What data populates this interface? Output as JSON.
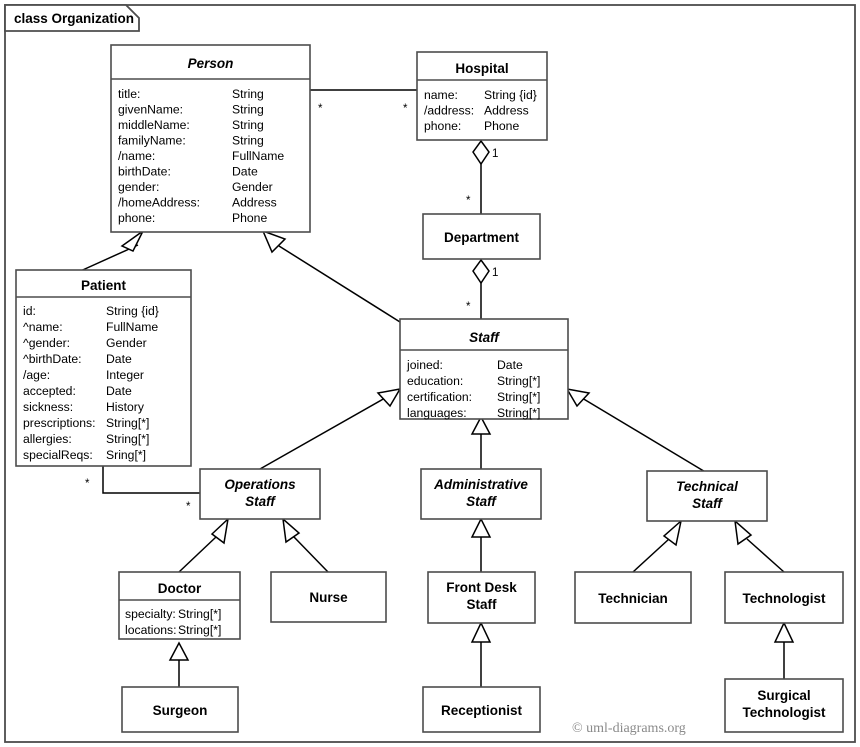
{
  "frame": {
    "label": "class Organization",
    "kind": "uml-class-diagram"
  },
  "copyright": "© uml-diagrams.org",
  "classes": {
    "person": {
      "name": "Person",
      "abstract": true,
      "attributes": [
        {
          "name": "title:",
          "type": "String"
        },
        {
          "name": "givenName:",
          "type": "String"
        },
        {
          "name": "middleName:",
          "type": "String"
        },
        {
          "name": "familyName:",
          "type": "String"
        },
        {
          "name": "/name:",
          "type": "FullName"
        },
        {
          "name": "birthDate:",
          "type": "Date"
        },
        {
          "name": "gender:",
          "type": "Gender"
        },
        {
          "name": "/homeAddress:",
          "type": "Address"
        },
        {
          "name": "phone:",
          "type": "Phone"
        }
      ]
    },
    "hospital": {
      "name": "Hospital",
      "abstract": false,
      "attributes": [
        {
          "name": "name:",
          "type": "String {id}"
        },
        {
          "name": "/address:",
          "type": "Address"
        },
        {
          "name": "phone:",
          "type": "Phone"
        }
      ]
    },
    "department": {
      "name": "Department",
      "abstract": false,
      "attributes": []
    },
    "patient": {
      "name": "Patient",
      "abstract": false,
      "attributes": [
        {
          "name": "id:",
          "type": "String {id}"
        },
        {
          "name": "^name:",
          "type": "FullName"
        },
        {
          "name": "^gender:",
          "type": "Gender"
        },
        {
          "name": "^birthDate:",
          "type": "Date"
        },
        {
          "name": "/age:",
          "type": "Integer"
        },
        {
          "name": "accepted:",
          "type": "Date"
        },
        {
          "name": "sickness:",
          "type": "History"
        },
        {
          "name": "prescriptions:",
          "type": "String[*]"
        },
        {
          "name": "allergies:",
          "type": "String[*]"
        },
        {
          "name": "specialReqs:",
          "type": "Sring[*]"
        }
      ]
    },
    "staff": {
      "name": "Staff",
      "abstract": true,
      "attributes": [
        {
          "name": "joined:",
          "type": "Date"
        },
        {
          "name": "education:",
          "type": "String[*]"
        },
        {
          "name": "certification:",
          "type": "String[*]"
        },
        {
          "name": "languages:",
          "type": "String[*]"
        }
      ]
    },
    "operations_staff": {
      "name": "Operations Staff",
      "name_line1": "Operations",
      "name_line2": "Staff",
      "abstract": true,
      "attributes": []
    },
    "administrative_staff": {
      "name": "Administrative Staff",
      "name_line1": "Administrative",
      "name_line2": "Staff",
      "abstract": true,
      "attributes": []
    },
    "technical_staff": {
      "name": "Technical Staff",
      "name_line1": "Technical",
      "name_line2": "Staff",
      "abstract": true,
      "attributes": []
    },
    "doctor": {
      "name": "Doctor",
      "abstract": false,
      "attributes": [
        {
          "name": "specialty:",
          "type": "String[*]"
        },
        {
          "name": "locations:",
          "type": "String[*]"
        }
      ]
    },
    "nurse": {
      "name": "Nurse",
      "abstract": false,
      "attributes": []
    },
    "front_desk_staff": {
      "name": "Front Desk Staff",
      "name_line1": "Front Desk",
      "name_line2": "Staff",
      "abstract": false,
      "attributes": []
    },
    "technician": {
      "name": "Technician",
      "abstract": false,
      "attributes": []
    },
    "technologist": {
      "name": "Technologist",
      "abstract": false,
      "attributes": []
    },
    "surgeon": {
      "name": "Surgeon",
      "abstract": false,
      "attributes": []
    },
    "receptionist": {
      "name": "Receptionist",
      "abstract": false,
      "attributes": []
    },
    "surgical_technologist": {
      "name": "Surgical Technologist",
      "name_line1": "Surgical",
      "name_line2": "Technologist",
      "abstract": false,
      "attributes": []
    }
  },
  "multiplicities": {
    "person_hospital_source": "*",
    "person_hospital_target": "*",
    "hospital_department_whole": "1",
    "hospital_department_part": "*",
    "department_staff_whole": "1",
    "department_staff_part": "*",
    "patient_operations_source": "*",
    "patient_operations_target": "*"
  },
  "relationships": [
    {
      "kind": "association",
      "from": "Person",
      "to": "Hospital",
      "from_mult": "*",
      "to_mult": "*"
    },
    {
      "kind": "aggregation",
      "whole": "Hospital",
      "part": "Department",
      "whole_mult": "1",
      "part_mult": "*"
    },
    {
      "kind": "aggregation",
      "whole": "Department",
      "part": "Staff",
      "whole_mult": "1",
      "part_mult": "*"
    },
    {
      "kind": "association",
      "from": "Patient",
      "to": "Operations Staff",
      "from_mult": "*",
      "to_mult": "*"
    },
    {
      "kind": "generalization",
      "general": "Person",
      "specific": "Patient"
    },
    {
      "kind": "generalization",
      "general": "Person",
      "specific": "Staff"
    },
    {
      "kind": "generalization",
      "general": "Staff",
      "specific": "Operations Staff"
    },
    {
      "kind": "generalization",
      "general": "Staff",
      "specific": "Administrative Staff"
    },
    {
      "kind": "generalization",
      "general": "Staff",
      "specific": "Technical Staff"
    },
    {
      "kind": "generalization",
      "general": "Operations Staff",
      "specific": "Doctor"
    },
    {
      "kind": "generalization",
      "general": "Operations Staff",
      "specific": "Nurse"
    },
    {
      "kind": "generalization",
      "general": "Administrative Staff",
      "specific": "Front Desk Staff"
    },
    {
      "kind": "generalization",
      "general": "Technical Staff",
      "specific": "Technician"
    },
    {
      "kind": "generalization",
      "general": "Technical Staff",
      "specific": "Technologist"
    },
    {
      "kind": "generalization",
      "general": "Doctor",
      "specific": "Surgeon"
    },
    {
      "kind": "generalization",
      "general": "Front Desk Staff",
      "specific": "Receptionist"
    },
    {
      "kind": "generalization",
      "general": "Technologist",
      "specific": "Surgical Technologist"
    }
  ],
  "colors": {
    "box_stroke": "#4d4d4d",
    "line": "#000000",
    "background": "#ffffff",
    "copyright_text": "#8a8a8a"
  }
}
